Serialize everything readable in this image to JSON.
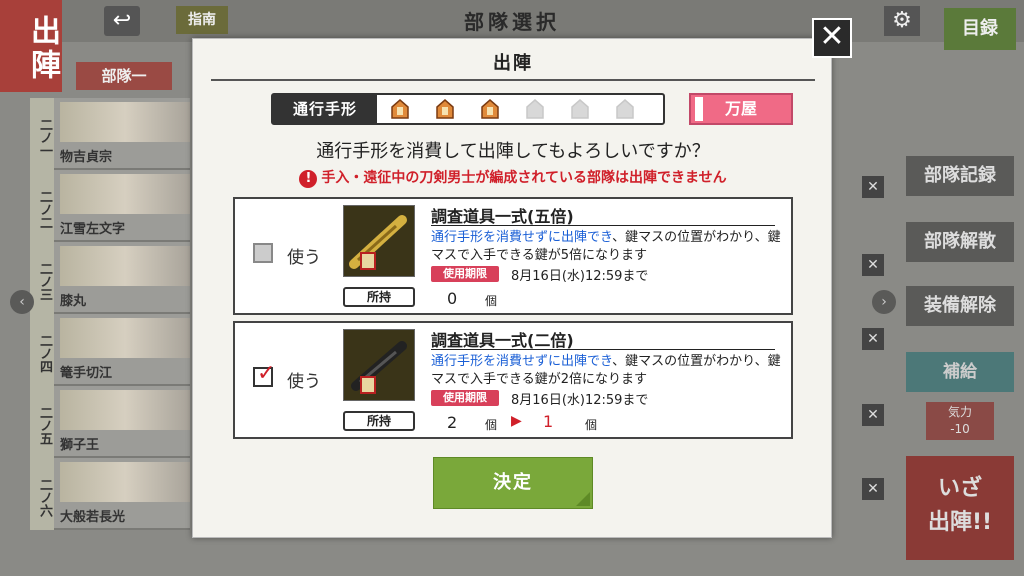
{
  "background": {
    "sortie_tab": "出陣",
    "guide_label": "指南",
    "screen_title": "部隊選択",
    "catalog_label": "目録",
    "squad_tab": "部隊一",
    "members": [
      {
        "slot": "二ノ一",
        "name": "物吉貞宗"
      },
      {
        "slot": "二ノ二",
        "name": "江雪左文字"
      },
      {
        "slot": "二ノ三",
        "name": "膝丸"
      },
      {
        "slot": "二ノ四",
        "name": "篭手切江"
      },
      {
        "slot": "二ノ五",
        "name": "獅子王"
      },
      {
        "slot": "二ノ六",
        "name": "大般若長光"
      }
    ],
    "side_buttons": [
      "部隊記録",
      "部隊解散",
      "装備解除"
    ],
    "supply_label": "補給",
    "kiryoku_label": "気力",
    "kiryoku_value": "-10",
    "go_label_1": "いざ",
    "go_label_2": "出陣!!"
  },
  "modal": {
    "title": "出陣",
    "pass_label": "通行手形",
    "pass_total": 6,
    "pass_owned": 3,
    "yorozuya_label": "万屋",
    "question": "通行手形を消費して出陣してもよろしいですか？",
    "warning": "手入・遠征中の刀剣男士が編成されている部隊は出陣できません",
    "items": [
      {
        "use_label": "使う",
        "checked": false,
        "name": "調査道具一式(五倍)",
        "desc_blue": "通行手形を消費せずに出陣でき",
        "desc_rest": "、鍵マスの位置がわかり、鍵マスで入手できる鍵が5倍になります",
        "limit_label": "使用期限",
        "limit_date": "8月16日(水)12:59まで",
        "own_label": "所持",
        "own_count": "0",
        "unit": "個"
      },
      {
        "use_label": "使う",
        "checked": true,
        "name": "調査道具一式(二倍)",
        "desc_blue": "通行手形を消費せずに出陣でき",
        "desc_rest": "、鍵マスの位置がわかり、鍵マスで入手できる鍵が2倍になります",
        "limit_label": "使用期限",
        "limit_date": "8月16日(水)12:59まで",
        "own_label": "所持",
        "own_count": "2",
        "unit": "個",
        "arrow": "▶",
        "after_count": "1",
        "after_unit": "個"
      }
    ],
    "decide_label": "決定",
    "close_symbol": "✕"
  }
}
